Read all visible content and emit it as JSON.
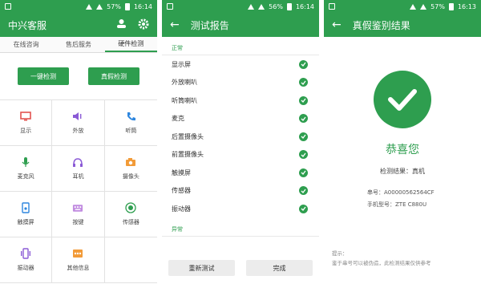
{
  "colors": {
    "brand": "#2e9e4f",
    "red": "#e3534f",
    "purple": "#8b5bd6",
    "blue": "#2e86de",
    "orange": "#f29b38"
  },
  "screen1": {
    "status": {
      "battery": "57%",
      "time": "16:14"
    },
    "title": "中兴客服",
    "tabs": [
      "在线咨询",
      "售后服务",
      "硬件检测"
    ],
    "buttons": {
      "one_key": "一键检测",
      "authenticity": "真假检测"
    },
    "grid": [
      {
        "label": "显示",
        "icon": "monitor-icon"
      },
      {
        "label": "外放",
        "icon": "speaker-icon"
      },
      {
        "label": "听筒",
        "icon": "phone-icon"
      },
      {
        "label": "麦克风",
        "icon": "microphone-icon"
      },
      {
        "label": "耳机",
        "icon": "headphones-icon"
      },
      {
        "label": "摄像头",
        "icon": "camera-icon"
      },
      {
        "label": "触摸屏",
        "icon": "touch-icon"
      },
      {
        "label": "按键",
        "icon": "keyboard-icon"
      },
      {
        "label": "传感器",
        "icon": "sensor-icon"
      },
      {
        "label": "振动器",
        "icon": "vibrate-icon"
      },
      {
        "label": "其他信息",
        "icon": "more-icon"
      },
      {
        "label": "",
        "icon": ""
      }
    ]
  },
  "screen2": {
    "status": {
      "battery": "56%",
      "time": "16:14"
    },
    "title": "测试报告",
    "normal_label": "正常",
    "items": [
      "显示屏",
      "外放喇叭",
      "听筒喇叭",
      "麦克",
      "后置摄像头",
      "前置摄像头",
      "触摸屏",
      "传感器",
      "振动器"
    ],
    "abnormal_label": "异常",
    "retest": "重新测试",
    "done": "完成"
  },
  "screen3": {
    "status": {
      "battery": "57%",
      "time": "16:13"
    },
    "title": "真假鉴别结果",
    "congrats": "恭喜您",
    "result": "检测结果：真机",
    "serial": "串号：A00000562564CF",
    "model": "手机型号：ZTE C880U",
    "tip_title": "提示：",
    "tip_text": "鉴于串号可以被伪造，此检测结果仅供参考"
  }
}
